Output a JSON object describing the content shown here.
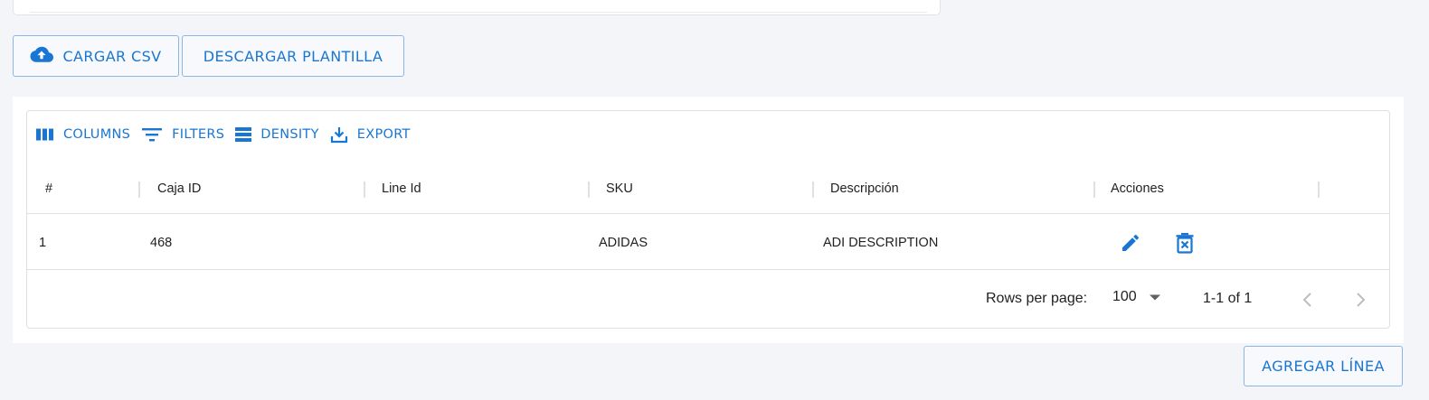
{
  "top_actions": {
    "upload_csv_label": "CARGAR CSV",
    "upload_icon": "cloud-upload-icon",
    "download_template_label": "DESCARGAR PLANTILLA"
  },
  "grid": {
    "toolbar": {
      "columns_label": "COLUMNS",
      "filters_label": "FILTERS",
      "density_label": "DENSITY",
      "export_label": "EXPORT"
    },
    "columns": [
      "#",
      "Caja ID",
      "Line Id",
      "SKU",
      "Descripción",
      "Acciones"
    ],
    "rows": [
      {
        "num": "1",
        "caja_id": "468",
        "line_id": "",
        "sku": "ADIDAS",
        "descripcion": "ADI DESCRIPTION",
        "actions": [
          "edit-icon",
          "delete-icon"
        ]
      }
    ],
    "footer": {
      "rows_per_page_label": "Rows per page:",
      "rows_per_page_value": "100",
      "range_text": "1-1 of 1"
    }
  },
  "bottom_actions": {
    "add_line_label": "AGREGAR LÍNEA"
  },
  "colors": {
    "accent": "#1976d2",
    "background": "#f3f5f9",
    "border": "#e0e0e0"
  }
}
